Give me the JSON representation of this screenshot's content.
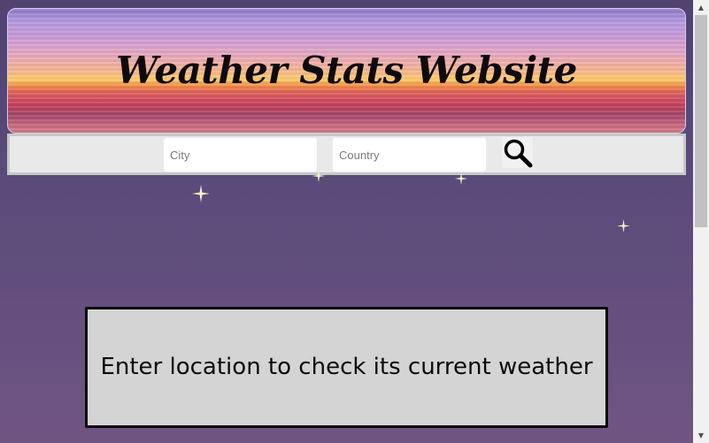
{
  "header": {
    "title": "Weather Stats Website"
  },
  "search": {
    "city_placeholder": "City",
    "country_placeholder": "Country",
    "button_icon": "search-icon"
  },
  "message": {
    "text": "Enter location to check its current weather"
  },
  "colors": {
    "page_background_top": "#4f4371",
    "page_background_bottom": "#705583",
    "search_bar_background": "#e9e9e9",
    "message_box_background": "#d4d4d4",
    "message_box_border": "#0a0a0a",
    "star_color": "#fff3c4"
  },
  "decorations": {
    "star_icon": "sparkle-icon"
  }
}
